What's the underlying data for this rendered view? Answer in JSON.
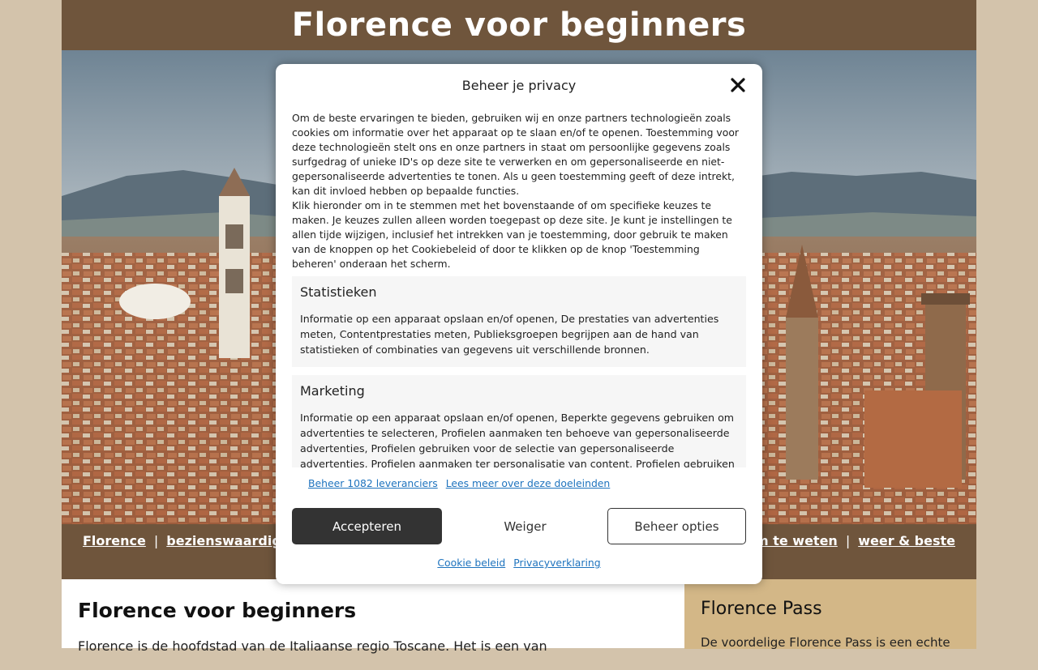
{
  "site": {
    "title": "Florence voor beginners"
  },
  "nav": {
    "left_items": [
      "Florence",
      "bezienswaardighe"
    ],
    "right_items": [
      "om te weten",
      "weer & beste"
    ],
    "separator": "|"
  },
  "main": {
    "heading": "Florence voor beginners",
    "first_line": "Florence is de hoofdstad van de Italiaanse regio Toscane. Het is ...",
    "first_line_visible": "Florence is de hoofdstad van de Italiaanse regio Toscane. Het is een van"
  },
  "aside": {
    "heading": "Florence Pass",
    "first_line": "De voordelige Florence Pass is een echte"
  },
  "cookie_modal": {
    "title": "Beheer je privacy",
    "intro_1": "Om de beste ervaringen te bieden, gebruiken wij en onze partners technologieën zoals cookies om informatie over het apparaat op te slaan en/of te openen. Toestemming voor deze technologieën stelt ons en onze partners in staat om persoonlijke gegevens zoals surfgedrag of unieke ID's op deze site te verwerken en om gepersonaliseerde en niet-gepersonaliseerde advertenties te tonen. Als u geen toestemming geeft of deze intrekt, kan dit invloed hebben op bepaalde functies.",
    "intro_2": "Klik hieronder om in te stemmen met het bovenstaande of om specifieke keuzes te maken. Je keuzes zullen alleen worden toegepast op deze site. Je kunt je instellingen te allen tijde wijzigen, inclusief het intrekken van je toestemming, door gebruik te maken van de knoppen op het Cookiebeleid of door te klikken op de knop 'Toestemming beheren' onderaan het scherm.",
    "categories": [
      {
        "title": "Statistieken",
        "text": "Informatie op een apparaat opslaan en/of openen, De prestaties van advertenties meten, Contentprestaties meten, Publieksgroepen begrijpen aan de hand van statistieken of combinaties van gegevens uit verschillende bronnen."
      },
      {
        "title": "Marketing",
        "text": "Informatie op een apparaat opslaan en/of openen, Beperkte gegevens gebruiken om advertenties te selecteren, Profielen aanmaken ten behoeve van gepersonaliseerde advertenties, Profielen gebruiken voor de selectie van gepersonaliseerde advertenties, Profielen aanmaken ter personalisatie van content, Profielen gebruiken ter selectie van"
      }
    ],
    "link_vendors": "Beheer 1082 leveranciers",
    "link_purposes": "Lees meer over deze doeleinden",
    "btn_accept": "Accepteren",
    "btn_deny": "Weiger",
    "btn_manage": "Beheer opties",
    "link_cookie_policy": "Cookie beleid",
    "link_privacy": "Privacyverklaring"
  },
  "colors": {
    "header_brown": "#6f553c",
    "body_bg": "#d3c3ab",
    "aside_bg": "#d3b787",
    "link_blue": "#1e73be",
    "accept_bg": "#333333"
  }
}
